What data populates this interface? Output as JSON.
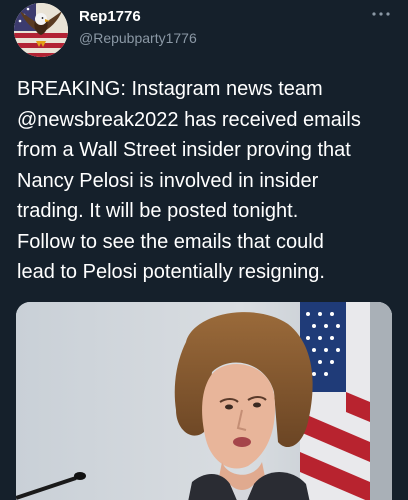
{
  "tweet": {
    "author": {
      "display_name": "Rep1776",
      "handle": "@Repubparty1776",
      "avatar_icon": "eagle-flag-avatar-icon"
    },
    "more_icon": "more-options-icon",
    "text": "BREAKING: Instagram news team\n@newsbreak2022 has received emails\nfrom a Wall Street insider proving that\nNancy Pelosi is involved in insider\ntrading. It will be posted tonight.\nFollow to see the emails that could\nlead to Pelosi potentially resigning.",
    "media": {
      "kind": "photo"
    }
  },
  "colors": {
    "background": "#15202b",
    "text_primary": "#ffffff",
    "text_secondary": "#8b98a5"
  }
}
